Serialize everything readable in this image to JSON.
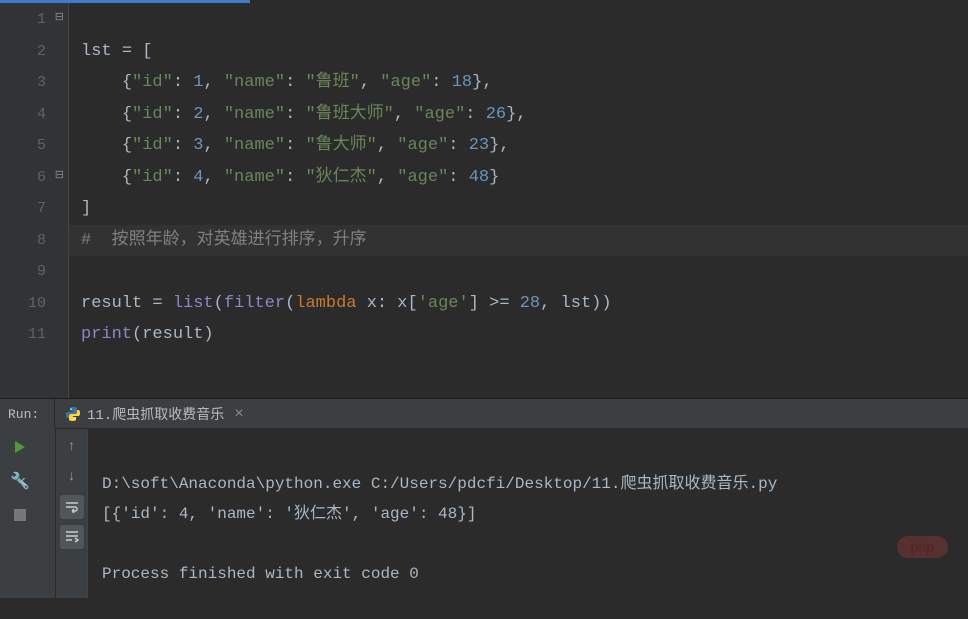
{
  "editor": {
    "line_numbers": [
      "1",
      "2",
      "3",
      "4",
      "5",
      "6",
      "7",
      "8",
      "9",
      "10",
      "11"
    ],
    "code": {
      "l1_ident": "lst ",
      "l1_op": "= [",
      "dict_open": "{",
      "dict_close": "}",
      "comma": ",",
      "key_id": "\"id\"",
      "key_name": "\"name\"",
      "key_age": "\"age\"",
      "colon": ": ",
      "rows": [
        {
          "id": "1",
          "name": "\"鲁班\"",
          "age": "18"
        },
        {
          "id": "2",
          "name": "\"鲁班大师\"",
          "age": "26"
        },
        {
          "id": "3",
          "name": "\"鲁大师\"",
          "age": "23"
        },
        {
          "id": "4",
          "name": "\"狄仁杰\"",
          "age": "48"
        }
      ],
      "l6_close": "]",
      "l7_comment": "#  按照年龄，对英雄进行排序，升序",
      "l8_result": "result ",
      "l8_eq": "= ",
      "l8_list": "list",
      "l8_p1": "(",
      "l8_filter": "filter",
      "l8_p2": "(",
      "l8_lambda": "lambda ",
      "l8_x": "x: x[",
      "l8_agekey": "'age'",
      "l8_cmp": "] >= ",
      "l8_28": "28",
      "l8_tail": ", lst))",
      "l9_print": "print",
      "l9_args": "(result)"
    }
  },
  "run": {
    "label": "Run:",
    "tab_title": "11.爬虫抓取收费音乐",
    "tab_close": "×",
    "out_line1": "D:\\soft\\Anaconda\\python.exe C:/Users/pdcfi/Desktop/11.爬虫抓取收费音乐.py",
    "out_line2": "[{'id': 4, 'name': '狄仁杰', 'age': 48}]",
    "out_blank": "",
    "out_line3": "Process finished with exit code 0"
  },
  "watermark": "php"
}
